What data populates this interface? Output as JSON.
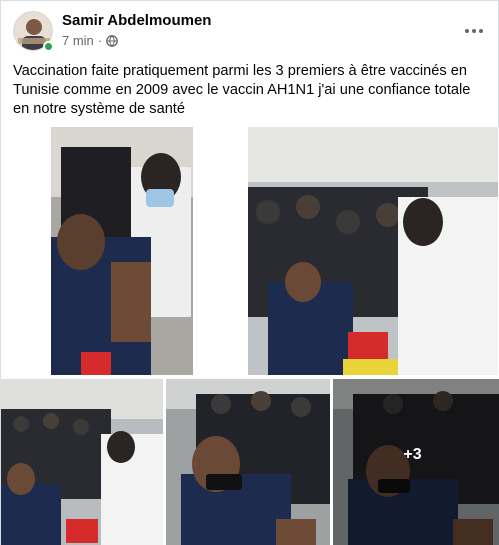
{
  "post": {
    "author": "Samir Abdelmoumen",
    "time": "7 min",
    "separator": "·",
    "privacy_icon": "globe-icon",
    "more_icon": "more-options-icon",
    "text": "Vaccination faite pratiquement parmi les 3 premiers à être vaccinés en Tunisie comme en 2009 avec le vaccin AH1N1 j'ai une confiance totale en notre système de santé"
  },
  "photos": {
    "extra_count_label": "+3",
    "items": [
      {
        "description_icon": "photo-vaccination-1"
      },
      {
        "description_icon": "photo-vaccination-2"
      },
      {
        "description_icon": "photo-vaccination-3"
      },
      {
        "description_icon": "photo-vaccination-4"
      },
      {
        "description_icon": "photo-vaccination-5"
      }
    ]
  },
  "colors": {
    "online_status": "#31a24c",
    "secondary_text": "#65676b",
    "primary_text": "#050505"
  }
}
